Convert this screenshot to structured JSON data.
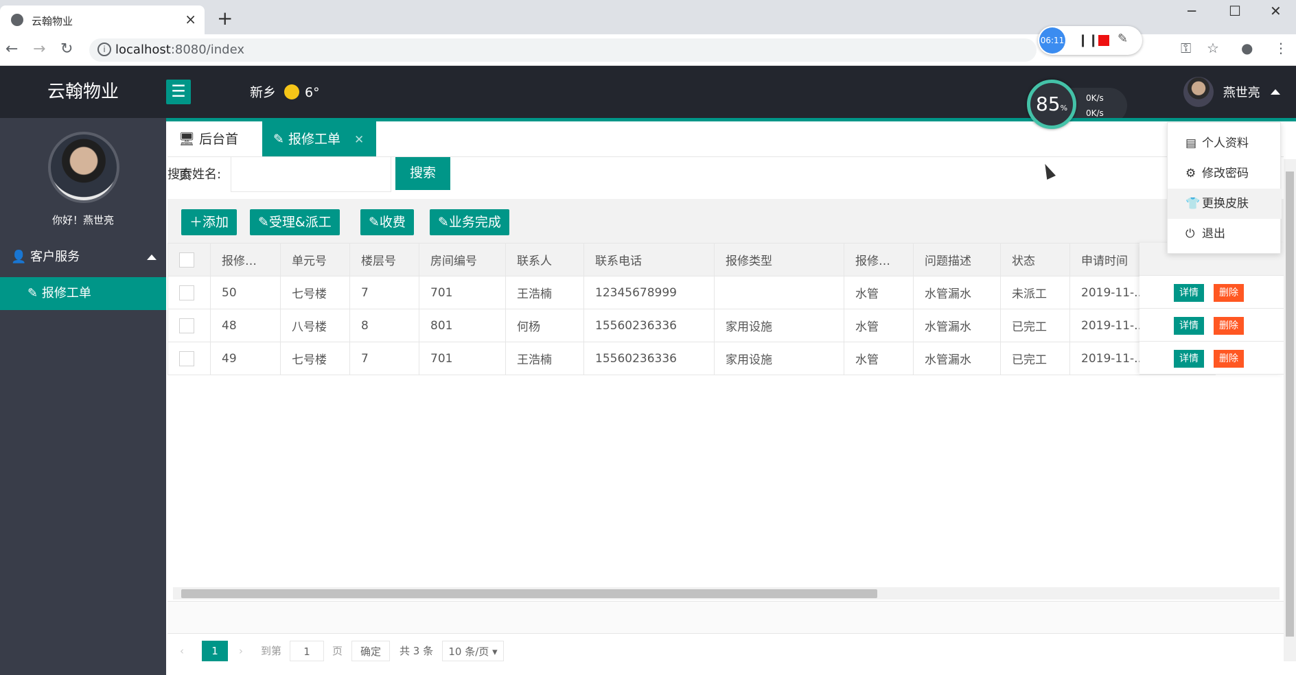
{
  "browser": {
    "tab_title": "云翰物业",
    "url_host": "localhost",
    "url_path": ":8080/index",
    "recorder_time": "06:11"
  },
  "header": {
    "logo": "云翰物业",
    "city": "新乡",
    "temperature": "6°",
    "cpu_percent": "85",
    "cpu_unit": "%",
    "upload_speed": "0K/s",
    "download_speed": "0K/s",
    "user_name": "燕世亮"
  },
  "sidebar": {
    "greeting": "你好！燕世亮",
    "group_label": "客户服务",
    "active_item": "报修工单"
  },
  "tabs": [
    {
      "label": "后台首页"
    },
    {
      "label": "报修工单"
    }
  ],
  "search": {
    "label": "搜索姓名:",
    "value": "",
    "button": "搜索"
  },
  "toolbar": {
    "add": "添加",
    "accept_dispatch": "受理&派工",
    "charge": "收费",
    "complete": "业务完成"
  },
  "table": {
    "columns": [
      "报修…",
      "单元号",
      "楼层号",
      "房间编号",
      "联系人",
      "联系电话",
      "报修类型",
      "报修…",
      "问题描述",
      "状态",
      "申请时间"
    ],
    "rows": [
      [
        "50",
        "七号楼",
        "7",
        "701",
        "王浩楠",
        "12345678999",
        "",
        "水管",
        "水管漏水",
        "未派工",
        "2019-11-.."
      ],
      [
        "48",
        "八号楼",
        "8",
        "801",
        "何杨",
        "15560236336",
        "家用设施",
        "水管",
        "水管漏水",
        "已完工",
        "2019-11-.."
      ],
      [
        "49",
        "七号楼",
        "7",
        "701",
        "王浩楠",
        "15560236336",
        "家用设施",
        "水管",
        "水管漏水",
        "已完工",
        "2019-11-.."
      ]
    ],
    "detail_label": "详情",
    "delete_label": "删除"
  },
  "pager": {
    "current_page": "1",
    "goto_label": "到第",
    "goto_value": "1",
    "page_unit": "页",
    "confirm": "确定",
    "total": "共 3 条",
    "page_size": "10 条/页"
  },
  "dropdown": {
    "items": [
      "个人资料",
      "修改密码",
      "更换皮肤",
      "退出"
    ]
  },
  "colors": {
    "accent": "#009688",
    "danger": "#ff5722",
    "header_bg": "#23262e",
    "sidebar_bg": "#393d49"
  }
}
